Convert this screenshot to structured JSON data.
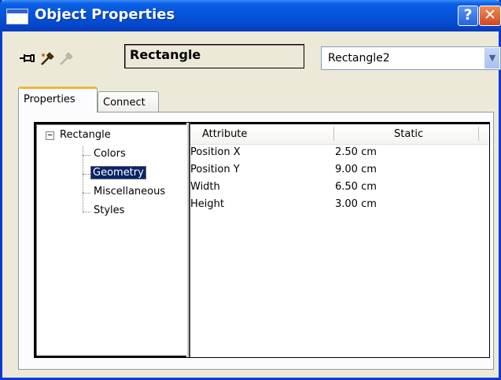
{
  "window": {
    "title": "Object Properties"
  },
  "icons": {
    "title": "window-icon",
    "help": "help-icon",
    "close": "close-icon",
    "pin": "pin-icon",
    "pick": "color-picker-icon",
    "pick_disabled": "color-picker-disabled-icon",
    "dropdown": "chevron-down-icon",
    "expander": "minus-icon"
  },
  "toolbar": {
    "object_type": "Rectangle",
    "object_name": "Rectangle2",
    "help_glyph": "?",
    "close_glyph": "✕",
    "dropdown_glyph": "▼",
    "expander_glyph": "−"
  },
  "tabs": [
    {
      "label": "Properties",
      "active": true
    },
    {
      "label": "Connect",
      "active": false
    }
  ],
  "tree": {
    "root": "Rectangle",
    "children": [
      "Colors",
      "Geometry",
      "Miscellaneous",
      "Styles"
    ],
    "selected": "Geometry"
  },
  "grid": {
    "columns": [
      "Attribute",
      "Static"
    ],
    "rows": [
      {
        "attribute": "Position X",
        "value": "2.50 cm"
      },
      {
        "attribute": "Position Y",
        "value": "9.00 cm"
      },
      {
        "attribute": "Width",
        "value": "6.50 cm"
      },
      {
        "attribute": "Height",
        "value": "3.00 cm"
      }
    ]
  },
  "colors": {
    "titlebar": "#0553d8",
    "selection": "#0a246a",
    "tab_highlight": "#f2b33d",
    "window_bg": "#ece9d8"
  }
}
